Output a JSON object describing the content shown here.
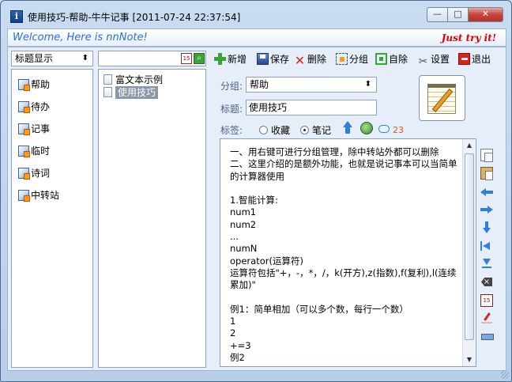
{
  "window": {
    "title": "使用技巧-帮助-牛牛记事 [2011-07-24 22:37:54]",
    "minimize": "—",
    "maximize": "□",
    "close": "✕"
  },
  "banner": {
    "welcome": "Welcome, Here is nnNote!",
    "slogan": "Just try it!"
  },
  "category_select": {
    "value": "标题显示"
  },
  "sidebar": {
    "items": [
      {
        "label": "帮助"
      },
      {
        "label": "待办"
      },
      {
        "label": "记事"
      },
      {
        "label": "临时"
      },
      {
        "label": "诗词"
      },
      {
        "label": "中转站"
      }
    ]
  },
  "search": {
    "value": ""
  },
  "notes": {
    "items": [
      {
        "label": "富文本示例"
      },
      {
        "label": "使用技巧",
        "selected": true
      }
    ]
  },
  "toolbar": {
    "new": "新增",
    "save": "保存",
    "delete": "删除",
    "group": "分组",
    "self": "自除",
    "settings": "设置",
    "exit": "退出"
  },
  "form": {
    "group_label": "分组:",
    "group_value": "帮助",
    "title_label": "标题:",
    "title_value": "使用技巧",
    "tag_label": "标签:",
    "tag_options": [
      "收藏",
      "笔记"
    ],
    "tag_selected": "笔记",
    "comment_count": "23"
  },
  "editor": {
    "content": "一、用右键可进行分组管理，除中转站外都可以删除\n二、这里介绍的是额外功能，也就是说记事本可以当简单的计算器使用\n\n1.智能计算:\nnum1\nnum2\n...\nnumN\noperator(运算符)\n运算符包括\"+，-，*，/，k(开方),z(指数),f(复利),l(连续累加)\"\n\n例1：简单相加（可以多个数，每行一个数）\n1\n2\n+=3\n例2"
  },
  "icons": {
    "accent": "#2f7fe0",
    "danger": "#e0201b",
    "success": "#3aa33a"
  }
}
